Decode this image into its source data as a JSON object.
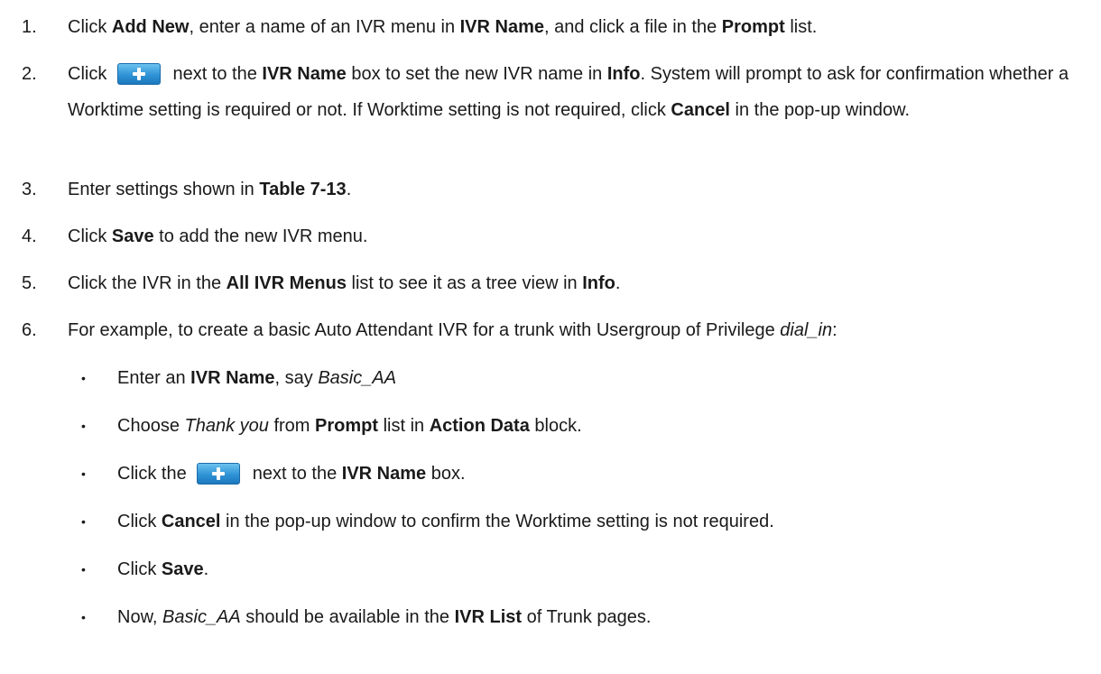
{
  "steps": [
    {
      "num": "1.",
      "parts": [
        "Click ",
        "Add New",
        ", enter a name of an IVR menu in ",
        "IVR Name",
        ", and click a file in the ",
        "Prompt",
        " list."
      ]
    },
    {
      "num": "2.",
      "parts": [
        "Click ",
        " next to the ",
        "IVR Name",
        " box to set the new IVR name in ",
        "Info",
        ". System will prompt to ask for confirmation whether a Worktime setting is required or not. If Worktime setting is not required, click ",
        "Cancel",
        " in the pop-up window."
      ]
    },
    {
      "num": "3.",
      "parts": [
        "Enter settings shown in ",
        "Table 7-13",
        "."
      ]
    },
    {
      "num": "4.",
      "parts": [
        "Click ",
        "Save",
        " to add the new IVR menu."
      ]
    },
    {
      "num": "5.",
      "parts": [
        "Click the IVR in the ",
        "All IVR Menus",
        " list to see it as a tree view in ",
        "Info",
        "."
      ]
    },
    {
      "num": "6.",
      "parts": [
        "For example, to create a basic Auto Attendant IVR for a trunk with Usergroup of Privilege ",
        "dial_in",
        ":"
      ]
    }
  ],
  "bullets": [
    {
      "parts": [
        "Enter an ",
        "IVR Name",
        ", say ",
        "Basic_AA"
      ]
    },
    {
      "parts": [
        "Choose ",
        "Thank you",
        " from ",
        "Prompt",
        " list in ",
        "Action Data",
        " block."
      ]
    },
    {
      "parts": [
        "Click the ",
        " next to the ",
        "IVR Name",
        " box."
      ]
    },
    {
      "parts": [
        "Click ",
        "Cancel",
        " in the pop-up window to confirm the Worktime setting is not required."
      ]
    },
    {
      "parts": [
        "Click ",
        "Save",
        "."
      ]
    },
    {
      "parts": [
        "Now, ",
        "Basic_AA",
        " should be available in the ",
        "IVR List",
        " of Trunk pages."
      ]
    }
  ],
  "bullet_symbol": "•",
  "icons": {
    "add_button": "plus-button-icon"
  },
  "colors": {
    "add_button_top": "#6cc3ef",
    "add_button_bottom": "#1d78bd"
  }
}
